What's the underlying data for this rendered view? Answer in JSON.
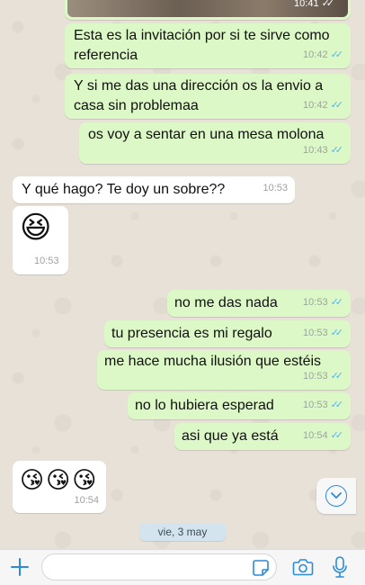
{
  "top_image": {
    "time": "10:41"
  },
  "messages": [
    {
      "text": "Esta es la invitación por si te sirve como referencia",
      "time": "10:42"
    },
    {
      "text": "Y si me das una dirección os la envio a casa sin problemaa",
      "time": "10:42"
    },
    {
      "text": "os voy a sentar en una mesa molona",
      "time": "10:43"
    },
    {
      "text": "Y qué hago? Te doy un sobre??",
      "time": "10:53"
    },
    {
      "text": "😆",
      "time": "10:53"
    },
    {
      "text": "no me das nada",
      "time": "10:53"
    },
    {
      "text": "tu presencia es mi regalo",
      "time": "10:53"
    },
    {
      "text": "me hace mucha ilusión que estéis",
      "time": "10:53"
    },
    {
      "text": "no lo hubiera esperad",
      "time": "10:53"
    },
    {
      "text": "asi que ya está",
      "time": "10:54"
    },
    {
      "text": "😘😘😘",
      "time": "10:54"
    }
  ],
  "date_separator": "vie, 3 may",
  "colors": {
    "outgoing_bubble": "#dcf8c6",
    "incoming_bubble": "#ffffff",
    "read_ticks": "#4fb3f6",
    "accent": "#2a8bd8"
  },
  "icons": {
    "attach": "plus-icon",
    "sticker": "sticker-icon",
    "camera": "camera-icon",
    "mic": "microphone-icon",
    "scroll": "chevron-down-icon"
  }
}
